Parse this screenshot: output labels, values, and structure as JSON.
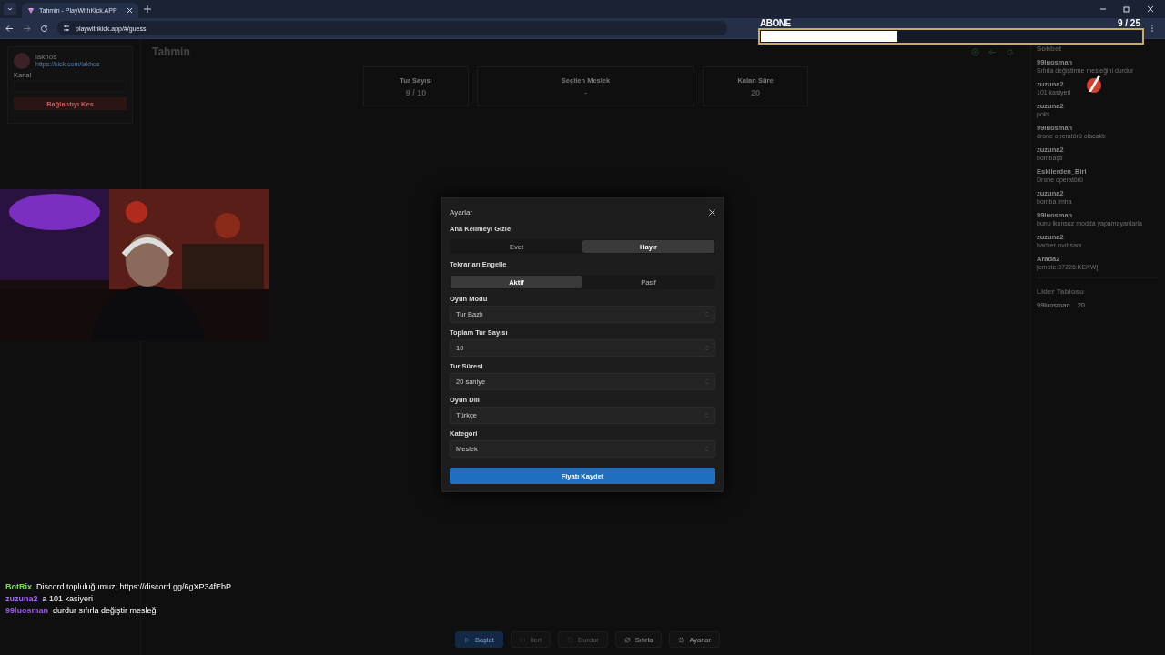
{
  "browser": {
    "tab_title": "Tahmin - PlayWithKick.APP",
    "url": "playwithkick.app/#/guess"
  },
  "channel": {
    "name": "iakhos",
    "link": "https://kick.com/iakhos",
    "label": "Kanal",
    "disconnect_button": "Bağlantıyı Kes"
  },
  "page": {
    "title": "Tahmin"
  },
  "stats": [
    {
      "label": "Tur Sayısı",
      "value": "9 / 10"
    },
    {
      "label": "Seçilen Meslek",
      "value": "-"
    },
    {
      "label": "Kalan Süre",
      "value": "20"
    }
  ],
  "chat": {
    "title": "Sohbet",
    "messages": [
      {
        "user": "99luosman",
        "text": "Sıfırla değiştirme mesleğini durdur"
      },
      {
        "user": "zuzuna2",
        "text": "101 kasiyeri"
      },
      {
        "user": "zuzuna2",
        "text": "polis"
      },
      {
        "user": "99luosman",
        "text": "drone operatörü olacaktı"
      },
      {
        "user": "zuzuna2",
        "text": "bombaştı"
      },
      {
        "user": "Eskilerden_Biri",
        "text": "Drone operatörü"
      },
      {
        "user": "zuzuna2",
        "text": "bomba imha"
      },
      {
        "user": "99luosman",
        "text": "bunu ikonsuz modda yapamayanlarla"
      },
      {
        "user": "zuzuna2",
        "text": "hacker rıvdısanı"
      },
      {
        "user": "Arada2",
        "text": "[emote:37226:KEKW]"
      }
    ]
  },
  "leaderboard": {
    "title": "Lider Tablosu",
    "entries": [
      {
        "name": "99luosman",
        "score": "20"
      }
    ]
  },
  "controls": [
    {
      "label": "Başlat",
      "kind": "play",
      "primary": true,
      "disabled": false
    },
    {
      "label": "İleri",
      "kind": "skip",
      "primary": false,
      "disabled": true
    },
    {
      "label": "Durdur",
      "kind": "stop",
      "primary": false,
      "disabled": true
    },
    {
      "label": "Sıfırla",
      "kind": "reset",
      "primary": false,
      "disabled": false
    },
    {
      "label": "Ayarlar",
      "kind": "settings",
      "primary": false,
      "disabled": false
    }
  ],
  "settings_dialog": {
    "title": "Ayarlar",
    "toggles": [
      {
        "label": "Ana Kelimeyi Gizle",
        "options": [
          {
            "label": "Evet",
            "selected": false
          },
          {
            "label": "Hayır",
            "selected": true
          }
        ]
      },
      {
        "label": "Tekrarları Engelle",
        "options": [
          {
            "label": "Aktif",
            "selected": true
          },
          {
            "label": "Pasif",
            "selected": false
          }
        ]
      }
    ],
    "selects": [
      {
        "label": "Oyun Modu",
        "value": "Tur Bazlı"
      },
      {
        "label": "Toplam Tur Sayısı",
        "value": "10"
      },
      {
        "label": "Tur Süresi",
        "value": "20 saniye"
      },
      {
        "label": "Oyun Dili",
        "value": "Türkçe"
      },
      {
        "label": "Kategori",
        "value": "Meslek"
      }
    ],
    "save_button": "Fiyatı Kaydet"
  },
  "stream_overlay": {
    "goal": {
      "label": "ABONE",
      "count": "9 / 25",
      "level": 0.36
    },
    "chat": [
      {
        "user": "BotRix",
        "color": "#72e24e",
        "text": "Discord topluluğumuz; https://discord.gg/6gXP34fEbP"
      },
      {
        "user": "zuzuna2",
        "color": "#a866f0",
        "text": "a 101 kasiyeri"
      },
      {
        "user": "99luosman",
        "color": "#9a5be8",
        "text": "durdur sıfırla değiştir mesleği"
      }
    ]
  }
}
